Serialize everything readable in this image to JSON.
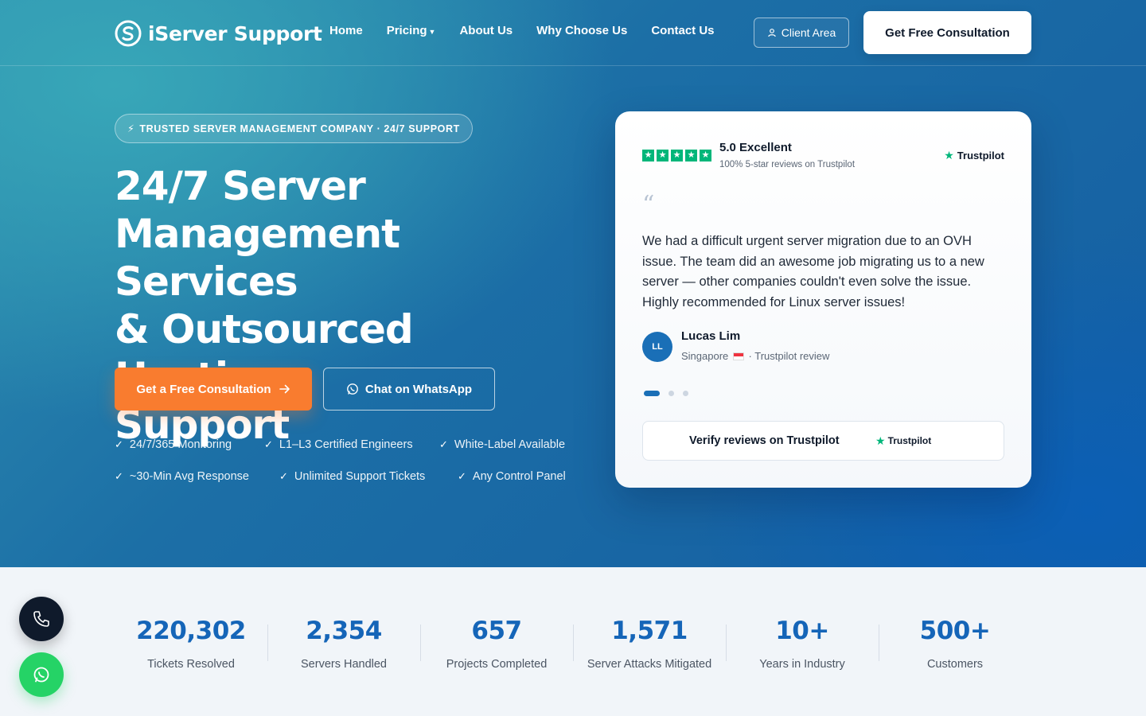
{
  "header": {
    "logo_text": "iServer Support",
    "nav": [
      {
        "label": "Home"
      },
      {
        "label": "Pricing"
      },
      {
        "label": "About Us"
      },
      {
        "label": "Why Choose Us"
      },
      {
        "label": "Contact Us"
      }
    ],
    "client_area_label": "Client Area",
    "consultation_label": "Get Free Consultation"
  },
  "hero": {
    "badge": "TRUSTED SERVER MANAGEMENT COMPANY · 24/7 SUPPORT",
    "headline_lines": [
      "24/7 Server",
      "Management Services",
      "& Outsourced Hosting",
      "Support"
    ],
    "cta_primary": "Get a Free Consultation",
    "cta_secondary": "Chat on WhatsApp",
    "features": [
      [
        "24/7/365 Monitoring",
        "L1–L3 Certified Engineers",
        "White-Label Available"
      ],
      [
        "~30-Min Avg Response",
        "Unlimited Support Tickets",
        "Any Control Panel"
      ]
    ]
  },
  "review_card": {
    "star_count": 5,
    "rating_title": "5.0 Excellent",
    "rating_sub": "100% 5-star reviews on Trustpilot",
    "brand": "Trustpilot",
    "quote_mark": "“",
    "quote": "We had a difficult urgent server migration due to an OVH issue. The team did an awesome job migrating us to a new server — other companies couldn't even solve the issue. Highly recommended for Linux server issues!",
    "reviewer_initials": "LL",
    "reviewer_name": "Lucas Lim",
    "reviewer_location": "Singapore",
    "reviewer_source": "· Trustpilot review",
    "slide_count": 3,
    "active_slide": 1,
    "verify_label": "Verify reviews on Trustpilot",
    "verify_brand": "Trustpilot"
  },
  "stats": [
    {
      "value": "220,302",
      "label": "Tickets Resolved"
    },
    {
      "value": "2,354",
      "label": "Servers Handled"
    },
    {
      "value": "657",
      "label": "Projects Completed"
    },
    {
      "value": "1,571",
      "label": "Server Attacks Mitigated"
    },
    {
      "value": "10+",
      "label": "Years in Industry"
    },
    {
      "value": "500+",
      "label": "Customers"
    }
  ],
  "colors": {
    "accent_orange": "#f97c2f",
    "brand_blue": "#1565b8",
    "trustpilot_green": "#00b67a",
    "whatsapp_green": "#25d366"
  }
}
